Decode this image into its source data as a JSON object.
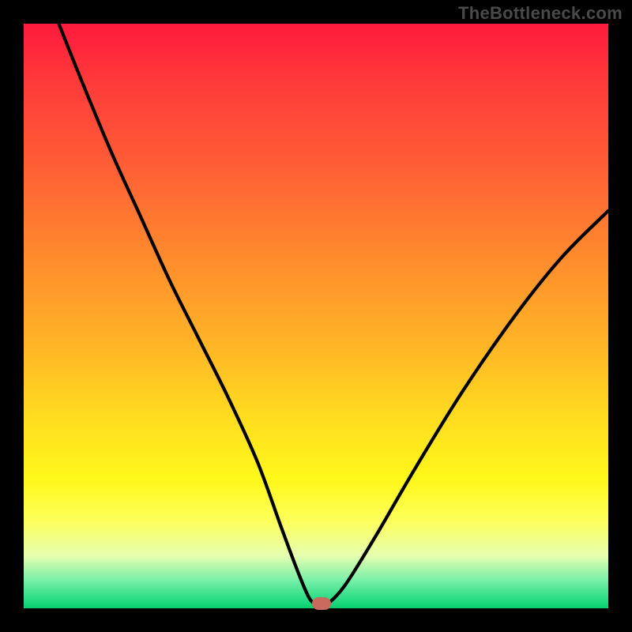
{
  "watermark": "TheBottleneck.com",
  "chart_data": {
    "type": "line",
    "title": "",
    "xlabel": "",
    "ylabel": "",
    "xlim": [
      0,
      100
    ],
    "ylim": [
      0,
      100
    ],
    "grid": false,
    "series": [
      {
        "name": "bottleneck-curve",
        "x": [
          6,
          10,
          15,
          20,
          25,
          30,
          35,
          40,
          44,
          47,
          49,
          50.5,
          52,
          55,
          60,
          67,
          75,
          84,
          92,
          100
        ],
        "values": [
          100,
          90,
          78,
          67,
          56,
          46,
          36,
          25,
          14,
          6,
          1.5,
          0.8,
          0.8,
          4,
          12,
          24,
          37,
          50,
          60,
          68
        ]
      }
    ],
    "annotations": [
      {
        "name": "marker",
        "x": 51,
        "y": 0.8,
        "shape": "rounded-rect",
        "color": "#c96a5f"
      }
    ],
    "background_gradient": {
      "direction": "top-to-bottom",
      "stops": [
        {
          "pos": 0,
          "color": "#ff1a3c"
        },
        {
          "pos": 25,
          "color": "#ff6035"
        },
        {
          "pos": 55,
          "color": "#ffb526"
        },
        {
          "pos": 78,
          "color": "#fff81a"
        },
        {
          "pos": 95,
          "color": "#7df0aa"
        },
        {
          "pos": 100,
          "color": "#0acb6e"
        }
      ]
    }
  }
}
